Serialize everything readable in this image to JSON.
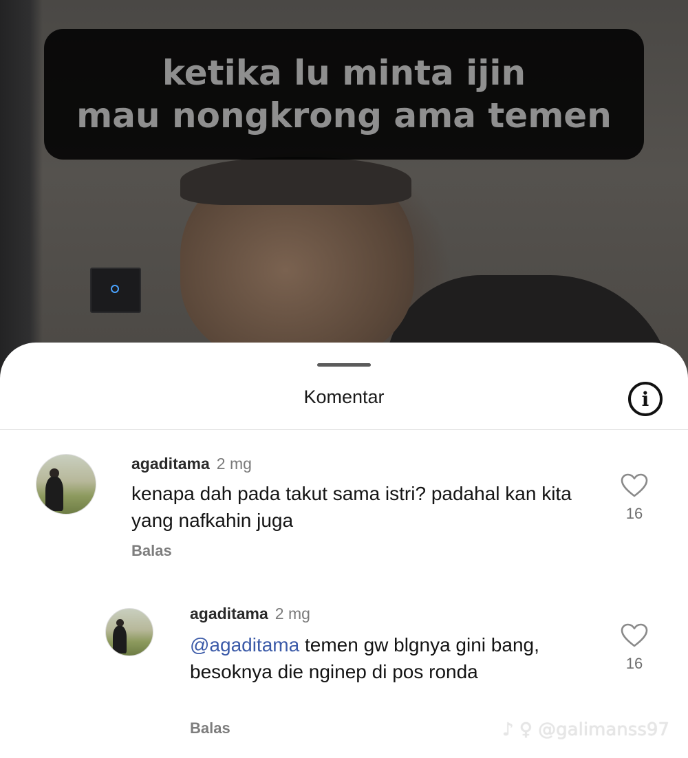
{
  "video": {
    "caption_line1": "ketika lu minta ijin",
    "caption_line2": "mau nongkrong ama temen"
  },
  "sheet": {
    "title": "Komentar",
    "info_icon": "info-circle-icon",
    "info_glyph": "i"
  },
  "comments": [
    {
      "username": "agaditama",
      "time": "2 mg",
      "text": "kenapa dah pada takut sama istri? padahal kan kita yang nafkahin juga",
      "reply_label": "Balas",
      "likes": "16"
    },
    {
      "username": "agaditama",
      "time": "2 mg",
      "mention": "@agaditama",
      "text": " temen gw blgnya gini bang, besoknya die nginep di pos ronda",
      "reply_label": "Balas",
      "likes": "16"
    }
  ],
  "watermark": "♪ ♀ @galimanss97",
  "colors": {
    "mention": "#3b5aa8",
    "caption_bg": "#000000",
    "caption_text": "#8f8f8f"
  }
}
